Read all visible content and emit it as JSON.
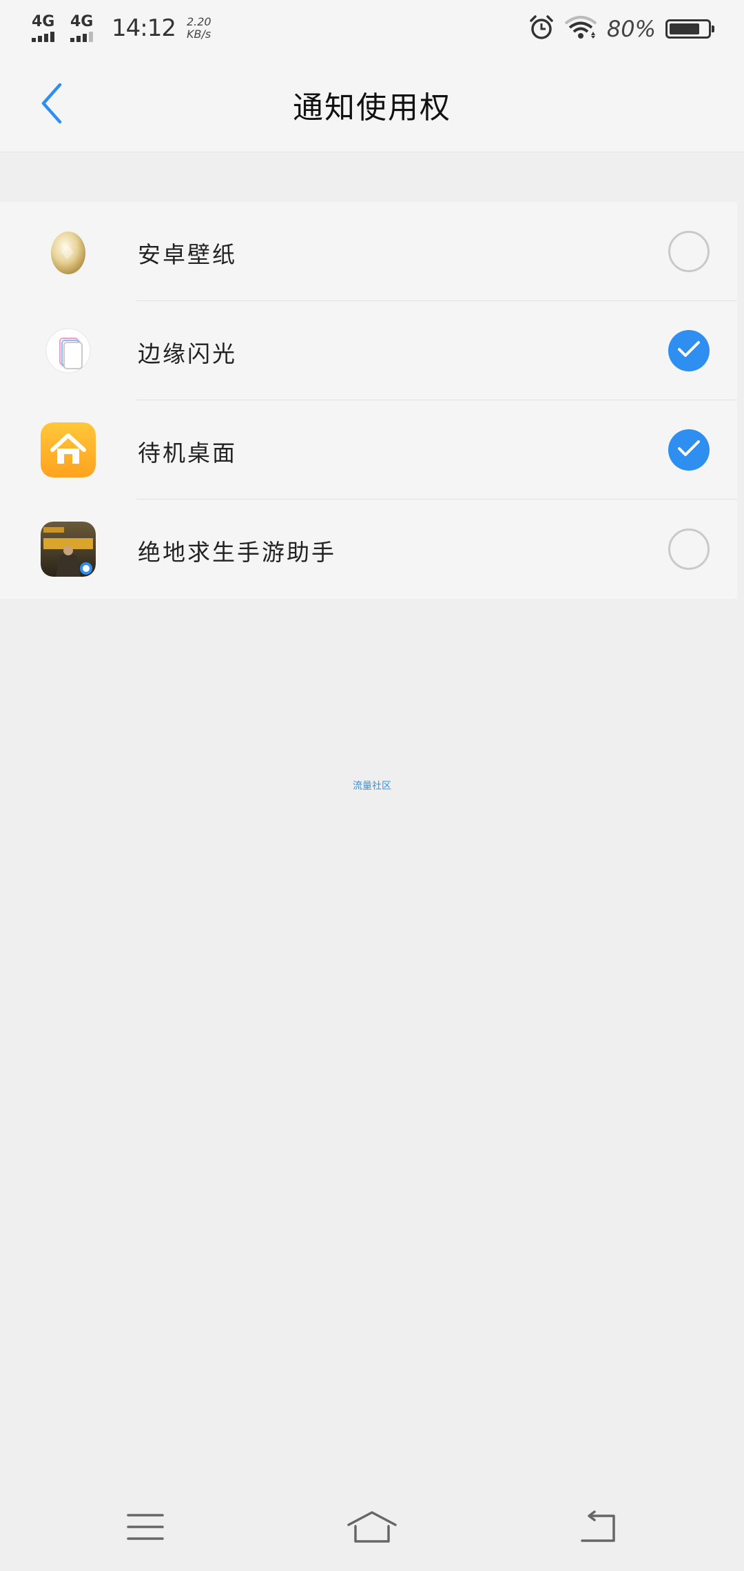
{
  "status_bar": {
    "network_1": "4G",
    "network_2": "4G",
    "time": "14:12",
    "speed_value": "2.20",
    "speed_unit": "KB/s",
    "battery_percent": "80%",
    "battery_level": 0.8,
    "icons": [
      "alarm-icon",
      "wifi-icon",
      "battery-icon"
    ]
  },
  "header": {
    "title": "通知使用权",
    "back_icon": "chevron-left-icon"
  },
  "apps": [
    {
      "name": "安卓壁纸",
      "icon": "egg-icon",
      "checked": false
    },
    {
      "name": "边缘闪光",
      "icon": "edge-flash-icon",
      "checked": true
    },
    {
      "name": "待机桌面",
      "icon": "home-icon",
      "checked": true
    },
    {
      "name": "绝地求生手游助手",
      "icon": "pubg-assistant-icon",
      "checked": false
    }
  ],
  "watermark": "流量社区",
  "nav_bar": {
    "icons": [
      "menu-icon",
      "home-nav-icon",
      "back-nav-icon"
    ]
  },
  "colors": {
    "accent": "#2e8ff0",
    "background": "#efeff0",
    "surface": "#f5f5f6",
    "divider": "#e0e0e0"
  }
}
